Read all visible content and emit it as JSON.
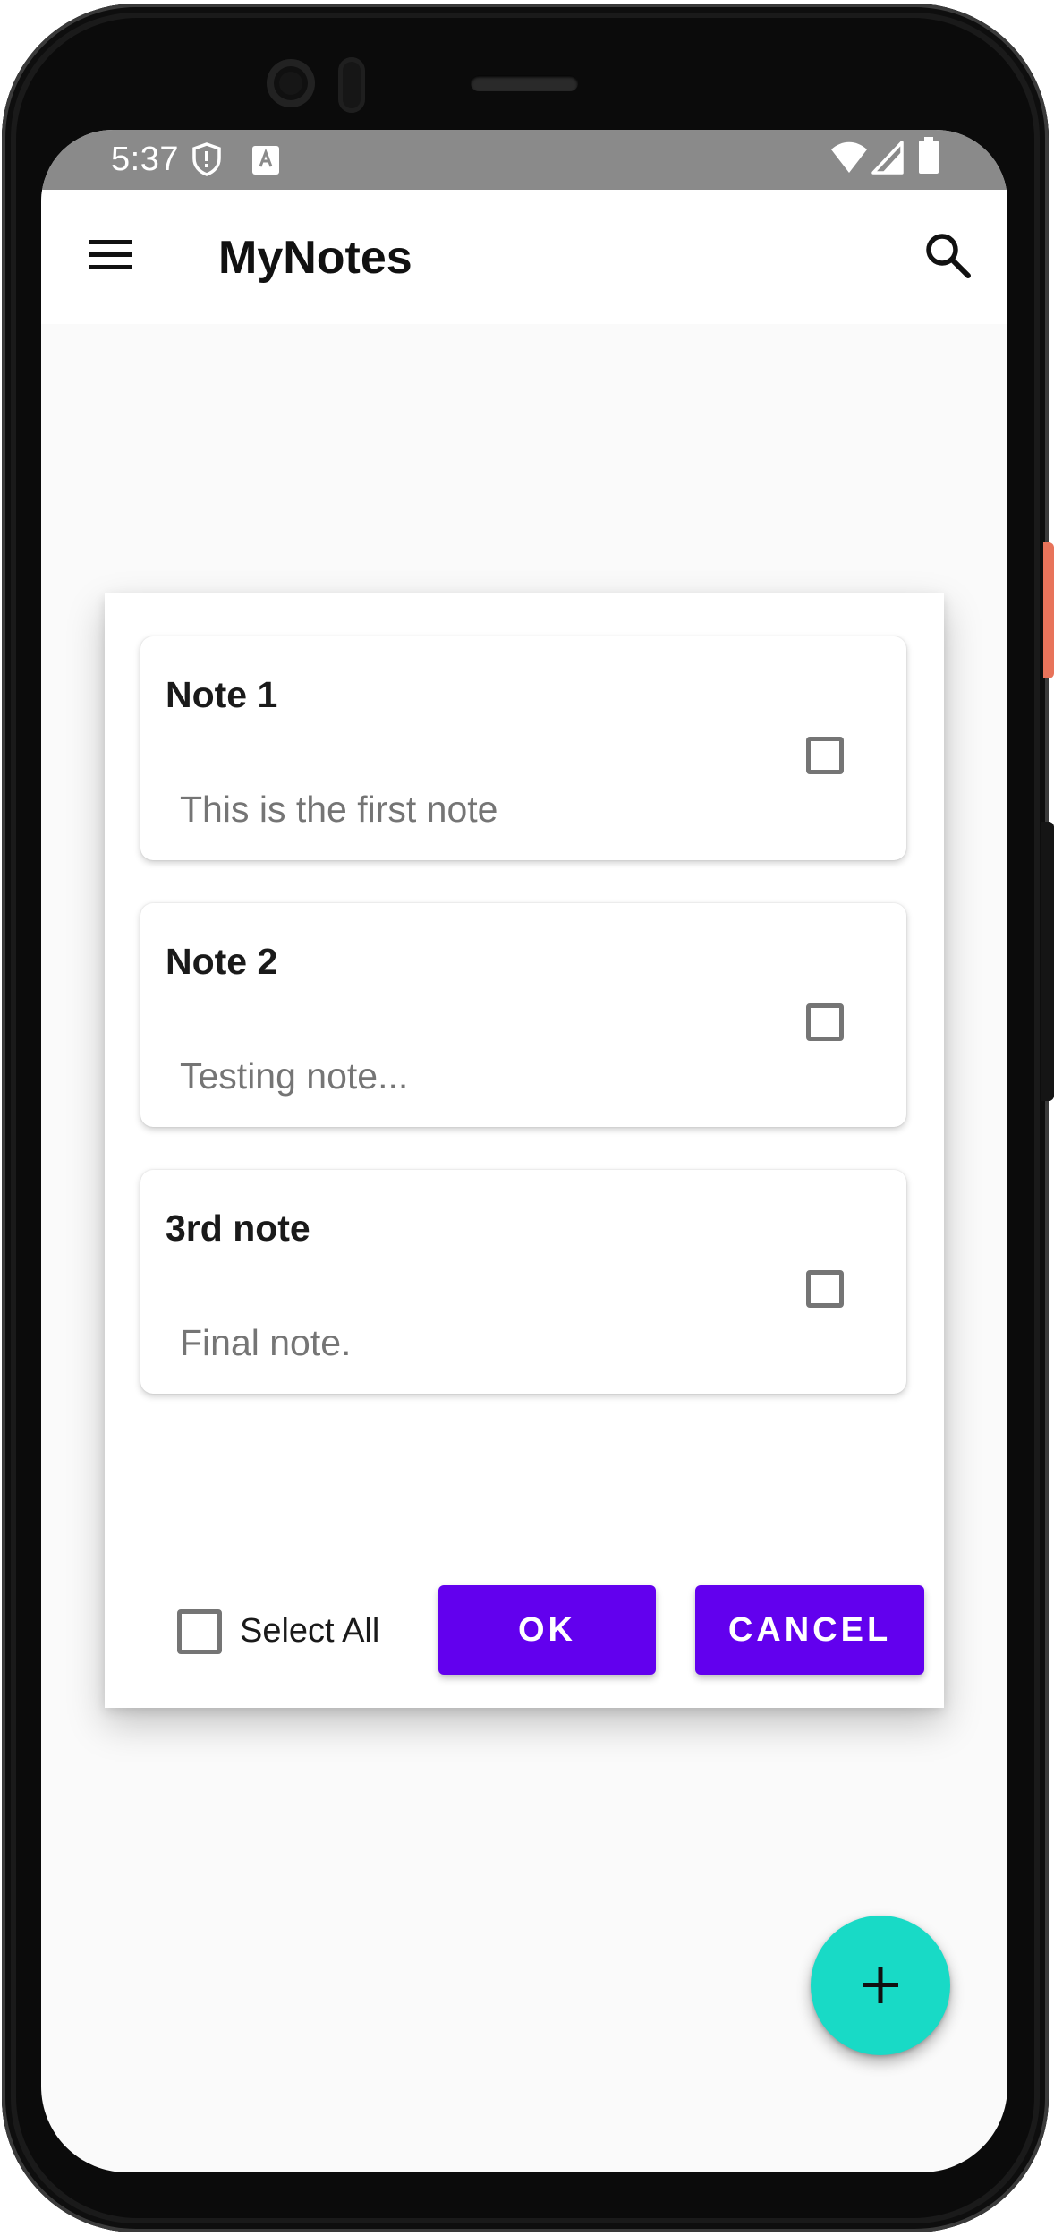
{
  "status_bar": {
    "time": "5:37",
    "icons": [
      "shield-icon",
      "text-a-icon",
      "wifi-icon",
      "signal-icon",
      "battery-icon"
    ]
  },
  "app_bar": {
    "title": "MyNotes",
    "menu_icon": "hamburger-menu-icon",
    "search_icon": "search-icon"
  },
  "dialog": {
    "notes": [
      {
        "title": "Note 1",
        "body": "This is the first note",
        "checked": false
      },
      {
        "title": "Note 2",
        "body": "Testing note...",
        "checked": false
      },
      {
        "title": "3rd note",
        "body": "Final note.",
        "checked": false
      }
    ],
    "select_all_label": "Select All",
    "select_all_checked": false,
    "ok_label": "OK",
    "cancel_label": "CANCEL"
  },
  "fab": {
    "icon": "plus-icon"
  },
  "colors": {
    "accent": "#6200ee",
    "fab": "#18dac6",
    "status_bar": "#8a8a8a"
  }
}
